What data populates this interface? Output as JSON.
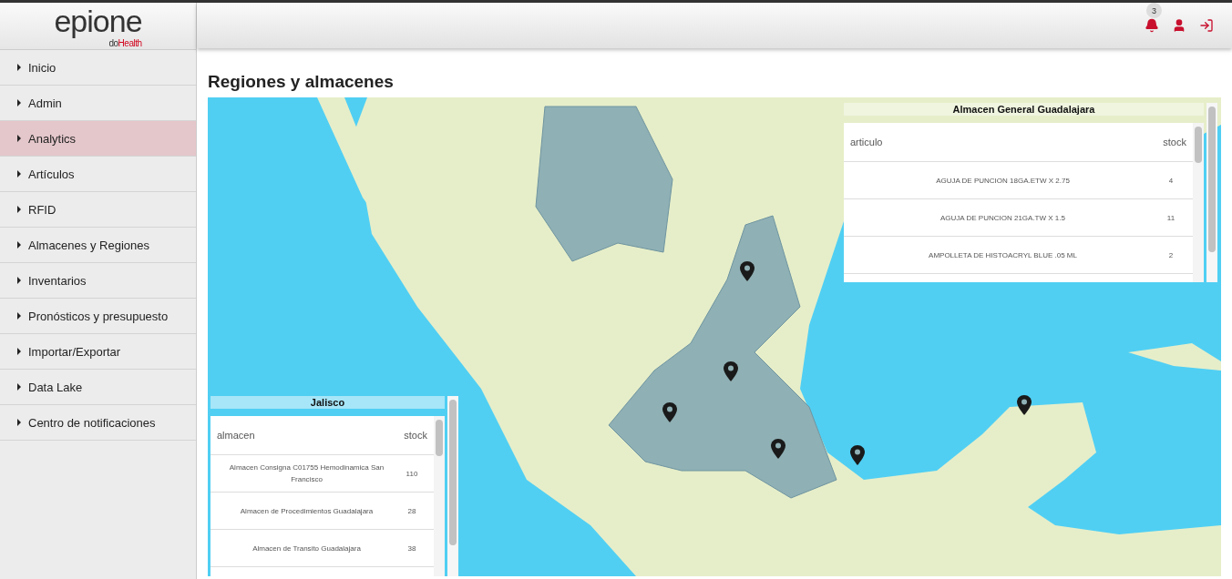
{
  "brand": {
    "name": "epione",
    "tagline_prefix": "do",
    "tagline_accent": "Health"
  },
  "header": {
    "notification_count": "3"
  },
  "sidebar": {
    "items": [
      {
        "label": "Inicio",
        "selected": false
      },
      {
        "label": "Admin",
        "selected": false
      },
      {
        "label": "Analytics",
        "selected": true
      },
      {
        "label": "Artículos",
        "selected": false
      },
      {
        "label": "RFID",
        "selected": false
      },
      {
        "label": "Almacenes y Regiones",
        "selected": false
      },
      {
        "label": "Inventarios",
        "selected": false
      },
      {
        "label": "Pronósticos y presupuesto",
        "selected": false
      },
      {
        "label": "Importar/Exportar",
        "selected": false
      },
      {
        "label": "Data Lake",
        "selected": false
      },
      {
        "label": "Centro de notificaciones",
        "selected": false
      }
    ]
  },
  "page": {
    "title": "Regiones y almacenes"
  },
  "warehouse_panel": {
    "title": "Almacen General Guadalajara",
    "columns": [
      "articulo",
      "stock"
    ],
    "rows": [
      {
        "name": "AGUJA DE PUNCION 18GA.ETW X 2.75",
        "stock": "4"
      },
      {
        "name": "AGUJA DE PUNCION 21GA.TW X 1.5",
        "stock": "11"
      },
      {
        "name": "AMPOLLETA DE HISTOACRYL BLUE .05 ML",
        "stock": "2"
      }
    ]
  },
  "region_panel": {
    "title": "Jalisco",
    "columns": [
      "almacen",
      "stock"
    ],
    "rows": [
      {
        "name": "Almacen Consigna C01755 Hemodinamica San Francisco",
        "stock": "110"
      },
      {
        "name": "Almacen de Procedimientos Guadalajara",
        "stock": "28"
      },
      {
        "name": "Almacen de Transito Guadalajara",
        "stock": "38"
      }
    ]
  }
}
